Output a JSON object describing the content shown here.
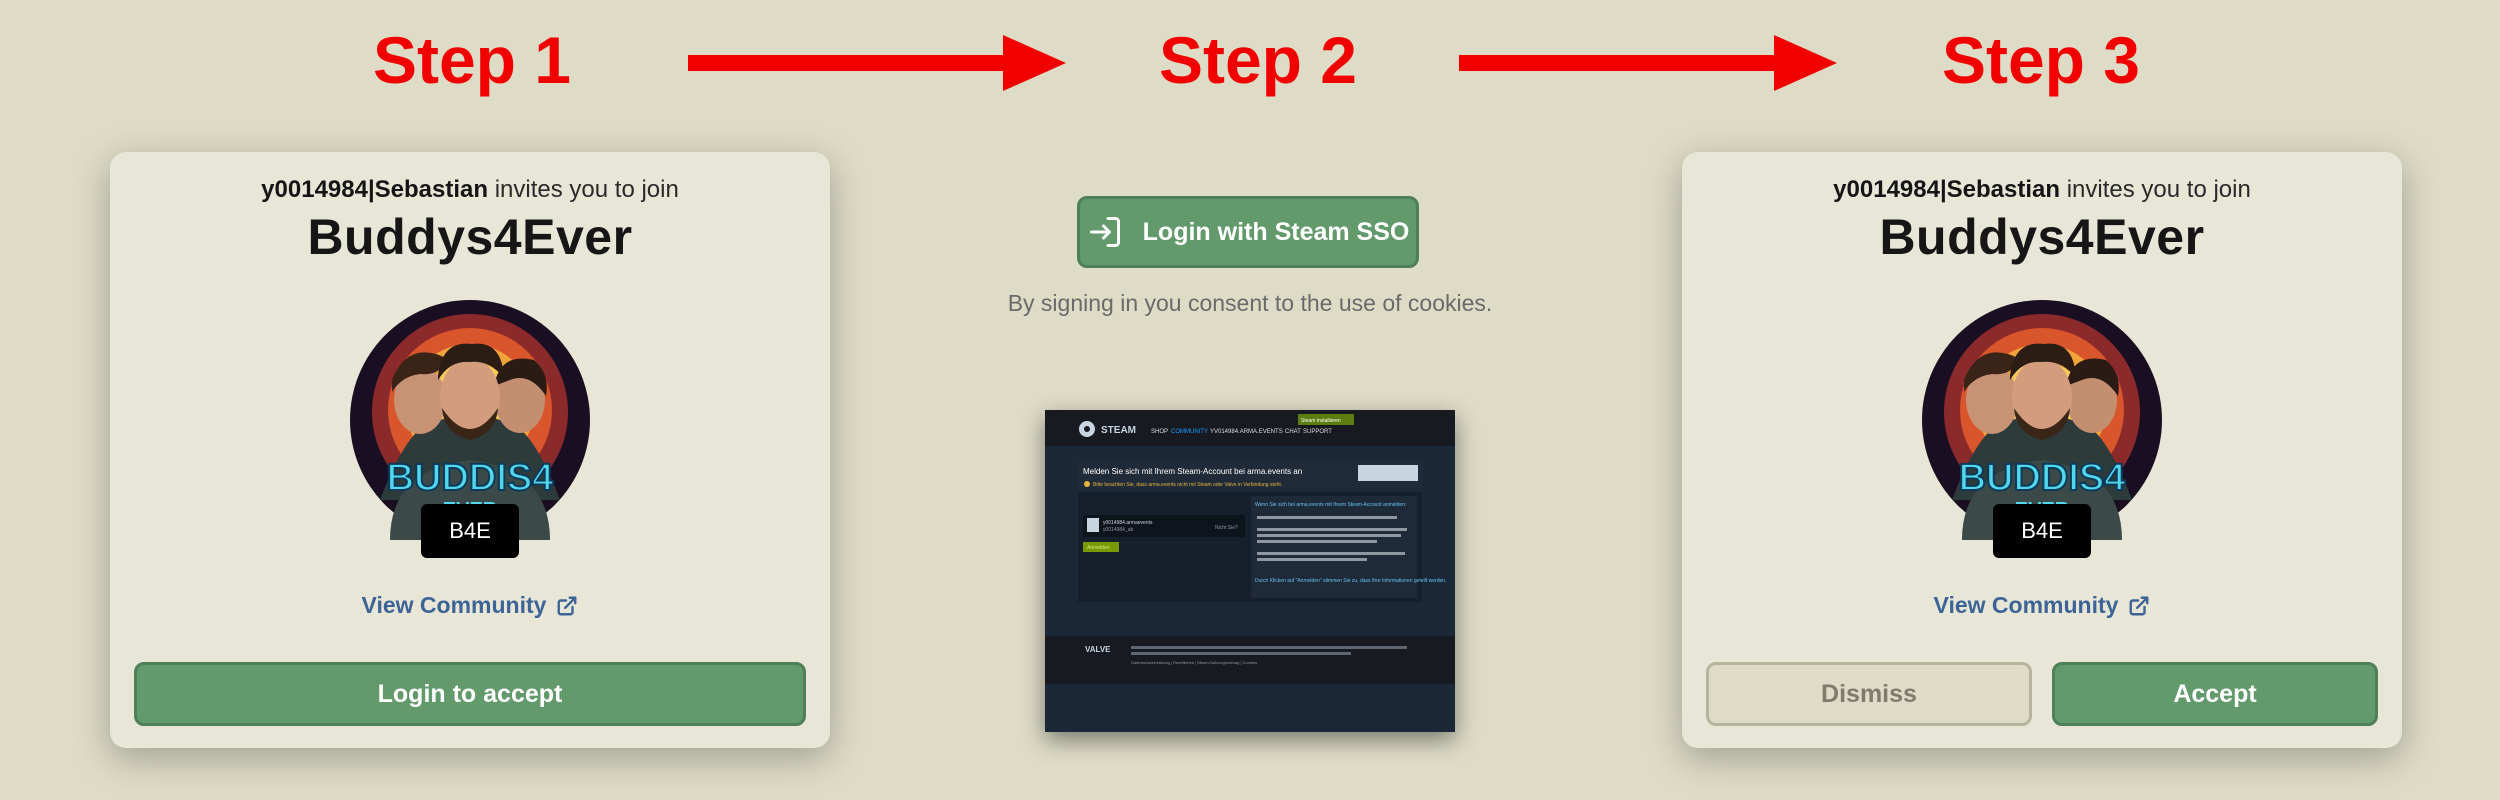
{
  "steps": [
    "Step 1",
    "Step 2",
    "Step 3"
  ],
  "invite": {
    "user": "y0014984|Sebastian",
    "text": " invites you to join",
    "group_name": "Buddys4Ever",
    "tag": "B4E",
    "logo_text": "BUDDIS4",
    "logo_subtext": "EVER",
    "view_community": "View Community"
  },
  "step1": {
    "login_button": "Login to accept"
  },
  "step2": {
    "sso_button": "Login with Steam SSO",
    "consent": "By signing in you consent to the use of cookies."
  },
  "step3": {
    "dismiss_button": "Dismiss",
    "accept_button": "Accept"
  },
  "steam_screenshot": {
    "logo": "STEAM",
    "nav": [
      "SHOP",
      "COMMUNITY",
      "YV014984.ARMA.EVENTS",
      "CHAT",
      "SUPPORT"
    ],
    "install_btn": "Steam installieren",
    "heading": "Melden Sie sich mit Ihrem Steam-Account bei arma.events an",
    "warning": "Bitte beachten Sie, dass arma.events nicht mit Steam oder Valve in Verbindung steht.",
    "account_name": "y0014984.armaevents",
    "account_sub": "y0014984_ab",
    "switch_link": "Nicht Sie?",
    "signin_btn": "Anmelden",
    "side_title": "Wenn Sie sich bei arma.events mit Ihrem Steam-Account anmelden:",
    "side_footer": "Durch Klicken auf \"Anmelden\" stimmen Sie zu, dass Ihre Informationen geteilt werden.",
    "footer_brand": "VALVE",
    "footer_links": "Datenschutzerklärung | Rechtliches | Steam-Nutzungsvertrag | Cookies"
  },
  "colors": {
    "background": "#dedcc6",
    "step_red": "#f20000",
    "button_green": "#629a6c",
    "link_blue": "#3d6496",
    "steam_bg": "#1b2838"
  },
  "icons": [
    "right-arrow-icon",
    "external-link-icon",
    "sign-in-icon",
    "steam-logo-icon",
    "warning-icon"
  ]
}
